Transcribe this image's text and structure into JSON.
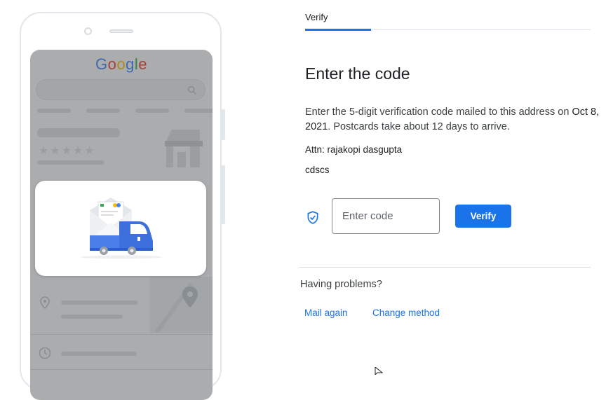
{
  "phone": {
    "logo_letters": [
      {
        "ch": "G",
        "color": "#4285f4"
      },
      {
        "ch": "o",
        "color": "#ea4335"
      },
      {
        "ch": "o",
        "color": "#fbbc05"
      },
      {
        "ch": "g",
        "color": "#4285f4"
      },
      {
        "ch": "l",
        "color": "#34a853"
      },
      {
        "ch": "e",
        "color": "#ea4335"
      }
    ],
    "rating_stars": "★★★★★"
  },
  "tabs": {
    "active_label": "Verify"
  },
  "main": {
    "title": "Enter the code",
    "description_pre": "Enter the 5-digit verification code mailed to this address on ",
    "description_date": "Oct 8, 2021",
    "description_post": ". Postcards take about 12 days to arrive.",
    "attn": "Attn: rajakopi dasgupta",
    "address": "cdscs"
  },
  "code_form": {
    "input_placeholder": "Enter code",
    "input_value": "",
    "verify_label": "Verify"
  },
  "help": {
    "heading": "Having problems?",
    "mail_again_label": "Mail again",
    "change_method_label": "Change method"
  },
  "colors": {
    "accent": "#1a73e8",
    "text_primary": "#202124",
    "text_secondary": "#3c4043",
    "divider": "#dadce0"
  },
  "icons": {
    "shield": "shield-check-icon",
    "search": "search-icon",
    "cursor": "mouse-pointer-icon"
  }
}
